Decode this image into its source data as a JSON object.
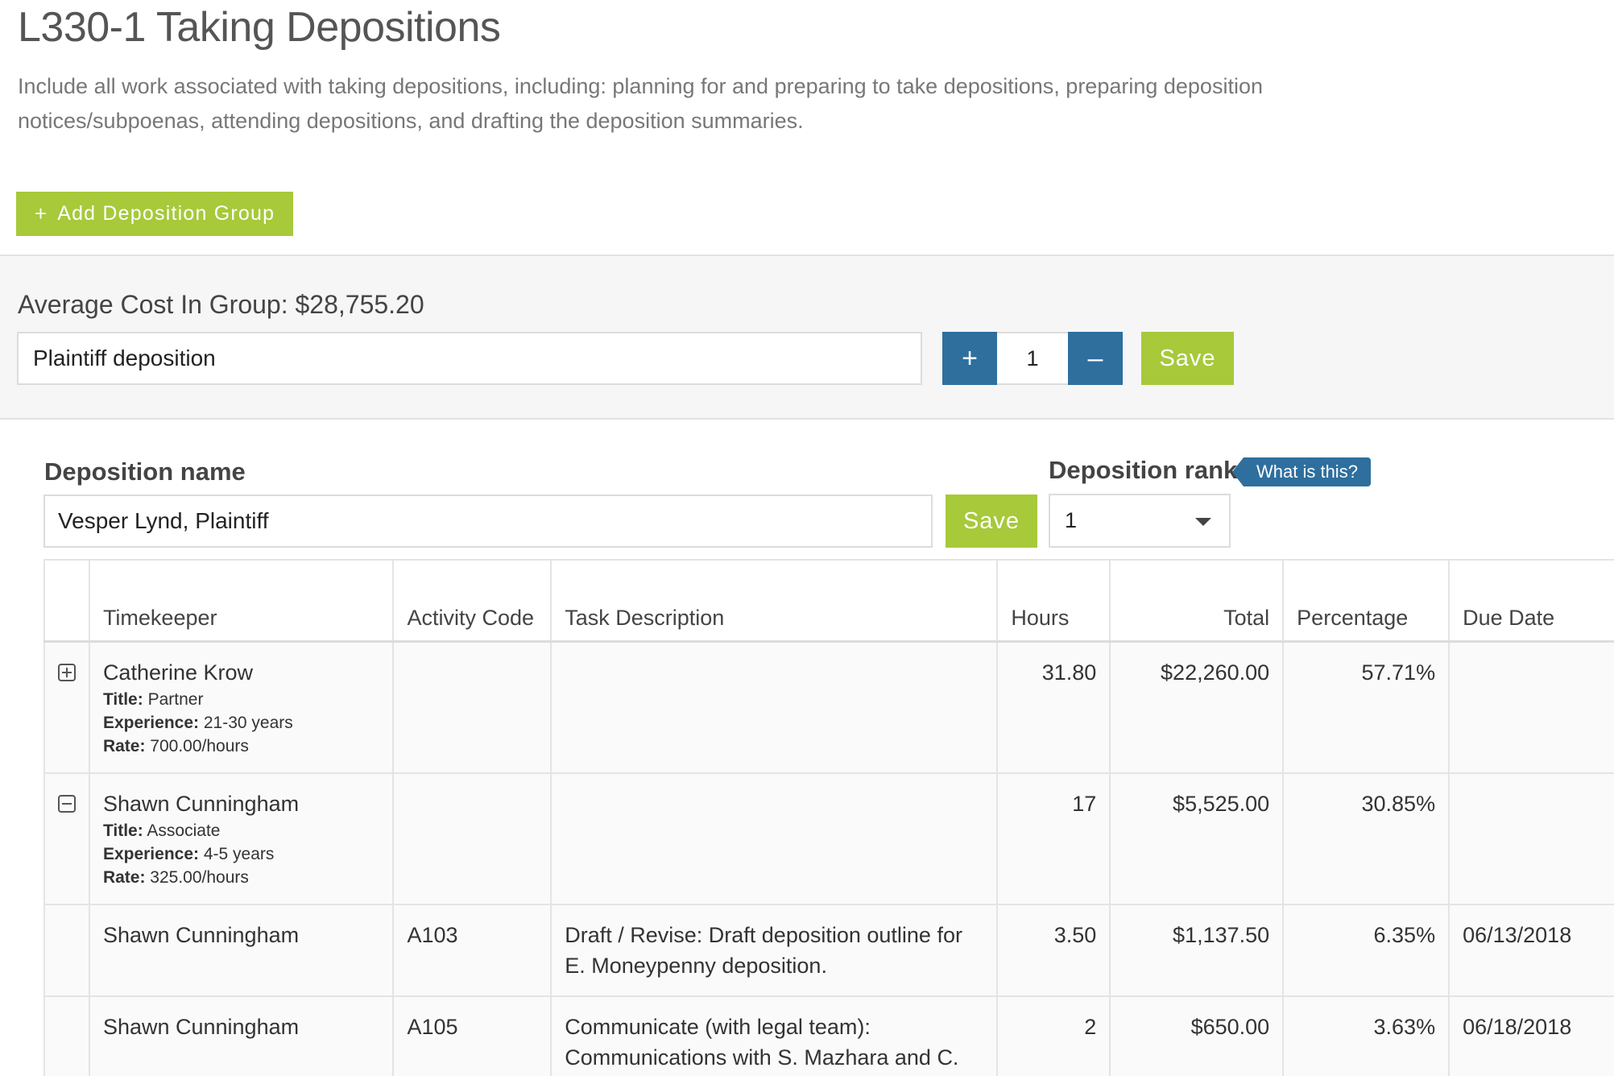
{
  "header": {
    "title": "L330-1 Taking Depositions",
    "description": "Include all work associated with taking depositions, including: planning for and preparing to take depositions, preparing deposition notices/subpoenas, attending depositions, and drafting the deposition summaries."
  },
  "add_group_button": {
    "icon": "+",
    "label": "Add Deposition Group"
  },
  "group": {
    "average_cost": "Average Cost In Group: $28,755.20",
    "name_value": "Plaintiff deposition",
    "stepper_plus": "+",
    "stepper_value": "1",
    "stepper_minus": "–",
    "save_label": "Save"
  },
  "deposition": {
    "name_label": "Deposition name",
    "name_value": "Vesper Lynd, Plaintiff",
    "save_label": "Save",
    "rank_label": "Deposition rank",
    "rank_help": "What is this?",
    "rank_value": "1"
  },
  "table": {
    "columns": [
      "Timekeeper",
      "Activity Code",
      "Task Description",
      "Hours",
      "Total",
      "Percentage",
      "Due Date"
    ],
    "rows": [
      {
        "toggle": "expand",
        "timekeeper": "Catherine Krow",
        "title_label": "Title:",
        "title": "Partner",
        "experience_label": "Experience:",
        "experience": "21-30 years",
        "rate_label": "Rate:",
        "rate": "700.00/hours",
        "activity_code": "",
        "task": "",
        "hours": "31.80",
        "total": "$22,260.00",
        "percentage": "57.71%",
        "due_date": ""
      },
      {
        "toggle": "collapse",
        "timekeeper": "Shawn Cunningham",
        "title_label": "Title:",
        "title": "Associate",
        "experience_label": "Experience:",
        "experience": "4-5 years",
        "rate_label": "Rate:",
        "rate": "325.00/hours",
        "activity_code": "",
        "task": "",
        "hours": "17",
        "total": "$5,525.00",
        "percentage": "30.85%",
        "due_date": ""
      },
      {
        "timekeeper": "Shawn Cunningham",
        "activity_code": "A103",
        "task": "Draft / Revise: Draft deposition outline for E. Moneypenny deposition.",
        "hours": "3.50",
        "total": "$1,137.50",
        "percentage": "6.35%",
        "due_date": "06/13/2018"
      },
      {
        "timekeeper": "Shawn Cunningham",
        "activity_code": "A105",
        "task": "Communicate (with legal team): Communications with S. Mazhara and C. Krow regarding deposition",
        "hours": "2",
        "total": "$650.00",
        "percentage": "3.63%",
        "due_date": "06/18/2018"
      }
    ]
  },
  "colors": {
    "accent_green": "#a7c93a",
    "accent_blue": "#2e6f9e"
  },
  "icons": {
    "expand": "plus-square-icon",
    "collapse": "minus-square-icon",
    "dropdown": "caret-down-icon"
  }
}
